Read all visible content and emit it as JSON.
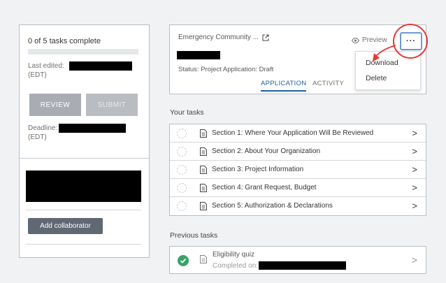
{
  "sidebar": {
    "progress_text": "0 of 5 tasks complete",
    "progress_fraction": 0,
    "last_edited_label": "Last edited:",
    "timezone": "(EDT)",
    "review_label": "REVIEW",
    "submit_label": "SUBMIT",
    "deadline_label": "Deadline:",
    "deadline_timezone": "(EDT)",
    "add_collaborator_label": "Add collaborator"
  },
  "header": {
    "project_title": "Emergency Community ...",
    "status_key": "Status:",
    "status_value": "Project Application: Draft",
    "tab_application": "APPLICATION",
    "tab_activity": "ACTIVITY",
    "preview_label": "Preview",
    "menu_label": "···"
  },
  "menu": {
    "items": [
      "Download",
      "Delete"
    ]
  },
  "your_tasks": {
    "title": "Your tasks",
    "items": [
      "Section 1: Where Your Application Will Be Reviewed",
      "Section 2: About Your Organization",
      "Section 3: Project Information",
      "Section 4: Grant Request, Budget",
      "Section 5: Authorization & Declarations"
    ]
  },
  "previous_tasks": {
    "title": "Previous tasks",
    "item_title": "Eligibility quiz",
    "item_sub": "Completed on:"
  },
  "colors": {
    "annotation_red": "#e53935",
    "tab_active": "#1f5f9e",
    "success_green": "#3aa06a"
  }
}
